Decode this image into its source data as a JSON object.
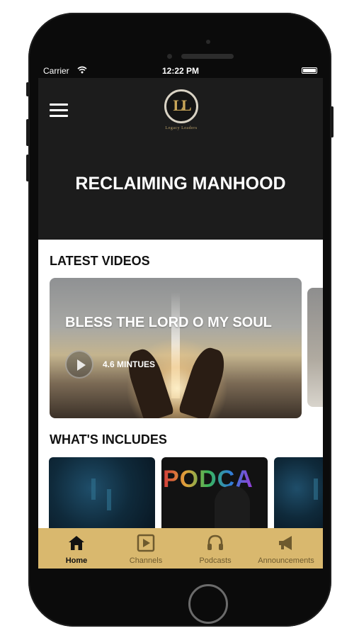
{
  "status_bar": {
    "carrier": "Carrier",
    "time": "12:22 PM"
  },
  "header": {
    "logo_letters": "LL",
    "logo_text": "Legacy Leaders",
    "title": "RECLAIMING MANHOOD"
  },
  "latest_videos": {
    "section_title": "LATEST VIDEOS",
    "items": [
      {
        "title": "BLESS THE LORD O MY SOUL",
        "duration": "4.6 MINTUES"
      }
    ]
  },
  "includes": {
    "section_title": "WHAT'S INCLUDES",
    "thumbnail_text": "PODCA"
  },
  "tab_bar": {
    "tabs": [
      {
        "label": "Home",
        "icon": "home-icon",
        "active": true
      },
      {
        "label": "Channels",
        "icon": "play-square-icon",
        "active": false
      },
      {
        "label": "Podcasts",
        "icon": "headphones-icon",
        "active": false
      },
      {
        "label": "Announcements",
        "icon": "megaphone-icon",
        "active": false
      }
    ]
  },
  "colors": {
    "header_bg": "#1c1c1c",
    "tab_bar_bg": "#d9b86e",
    "accent_gold": "#c9a659"
  }
}
